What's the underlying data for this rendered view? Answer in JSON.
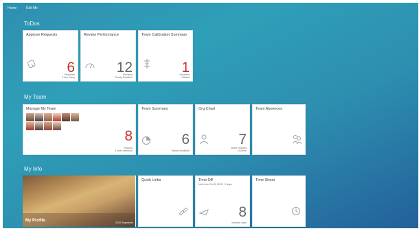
{
  "topbar": {
    "home": "Home",
    "edit": "Edit Me"
  },
  "sections": {
    "todos": "ToDos",
    "my_team": "My Team",
    "my_info": "My Info"
  },
  "todos": {
    "approve": {
      "title": "Approve Requests",
      "value": "6",
      "sub1": "Requests",
      "sub2": "6 due today"
    },
    "review": {
      "title": "Review Performance",
      "value": "12",
      "sub1": "Reviews",
      "sub2": "Ready Deadline"
    },
    "calibration": {
      "title": "Team Calibration Summary",
      "value": "1",
      "sub1": "Sessions",
      "sub2": "Started"
    }
  },
  "team": {
    "manage": {
      "title": "Manage My Team",
      "value": "8",
      "sub1": "Reports",
      "sub2": "4 need attention"
    },
    "summary": {
      "title": "Team Summary",
      "value": "6",
      "sub1": "Weeks Available"
    },
    "org": {
      "title": "Org Chart",
      "value": "7",
      "sub1": "Direct Reports",
      "sub2": "1/8 level"
    },
    "absences": {
      "title": "Team Absences"
    }
  },
  "info": {
    "profile": {
      "name": "My Profile",
      "sub": "2010 Snapshots"
    },
    "quick": {
      "title": "Quick Links"
    },
    "timeoff": {
      "title": "Time Off",
      "subtitle": "Next time Oct 5, 2015 · 3 days",
      "value": "8",
      "sub1": "Vacation days"
    },
    "timesheet": {
      "title": "Time Sheet"
    }
  },
  "colors": {
    "accent_red": "#c8302c",
    "background_top": "#2f9fb8",
    "background_bottom": "#23609a"
  }
}
